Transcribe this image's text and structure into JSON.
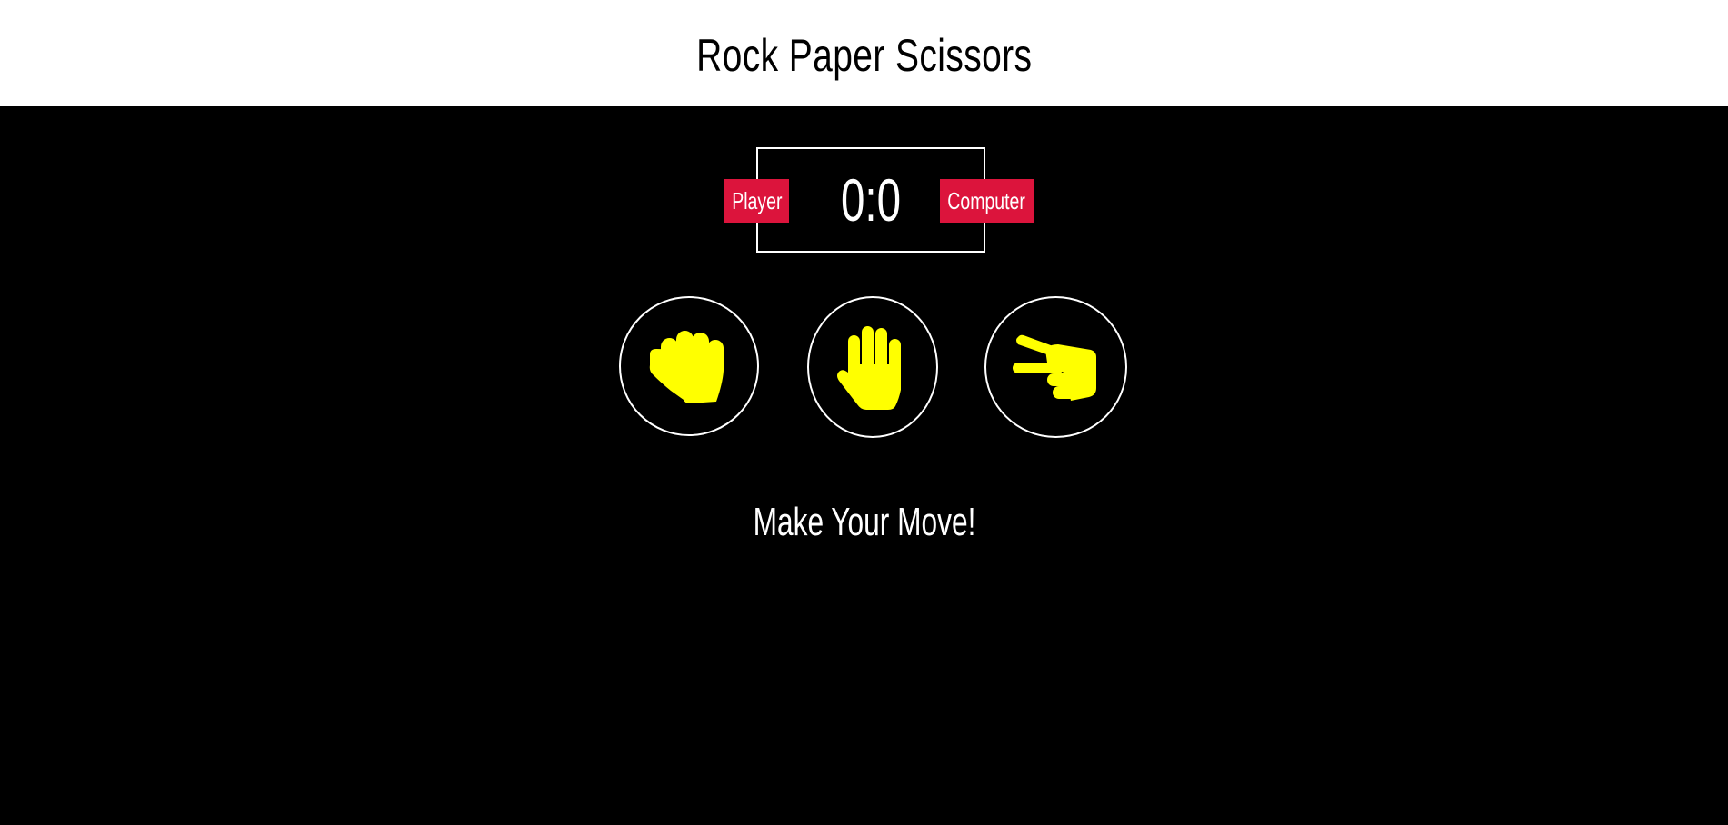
{
  "header": {
    "title": "Rock Paper Scissors"
  },
  "scoreboard": {
    "player_label": "Player",
    "computer_label": "Computer",
    "score": "0:0"
  },
  "choices": [
    {
      "name": "rock",
      "icon": "hand-rock-icon"
    },
    {
      "name": "paper",
      "icon": "hand-paper-icon"
    },
    {
      "name": "scissors",
      "icon": "hand-scissors-icon"
    }
  ],
  "message": "Make Your Move!",
  "colors": {
    "header_bg": "#ffffff",
    "main_bg": "#000000",
    "badge_bg": "#dc143c",
    "icon_fill": "#ffff00",
    "border": "#ffffff",
    "text": "#ffffff"
  }
}
